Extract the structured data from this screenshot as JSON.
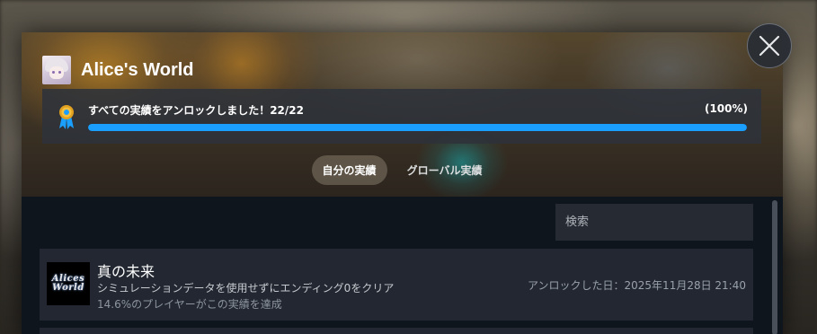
{
  "game": {
    "title": "Alice's World"
  },
  "progress": {
    "text": "すべての実績をアンロックしました！22/22",
    "percent_label": "(100%)",
    "unlocked": 22,
    "total": 22,
    "fraction": 1.0,
    "bar_color": "#1a9fff"
  },
  "tabs": [
    {
      "label": "自分の実績",
      "active": true
    },
    {
      "label": "グローバル実績",
      "active": false
    }
  ],
  "search": {
    "placeholder": "検索",
    "value": ""
  },
  "achievements": [
    {
      "icon_text_line1": "Alices",
      "icon_text_line2": "World",
      "name": "真の未来",
      "description": "シミュレーションデータを使用せずにエンディング0をクリア",
      "global_percent_text": "14.6%のプレイヤーがこの実績を達成",
      "unlock_date_text": "アンロックした日：2025年11月28日 21:40"
    }
  ],
  "icons": {
    "close": "close-icon",
    "ribbon": "ribbon-icon"
  },
  "colors": {
    "accent": "#1a9fff",
    "panel": "#222731",
    "background": "#0f151c"
  }
}
